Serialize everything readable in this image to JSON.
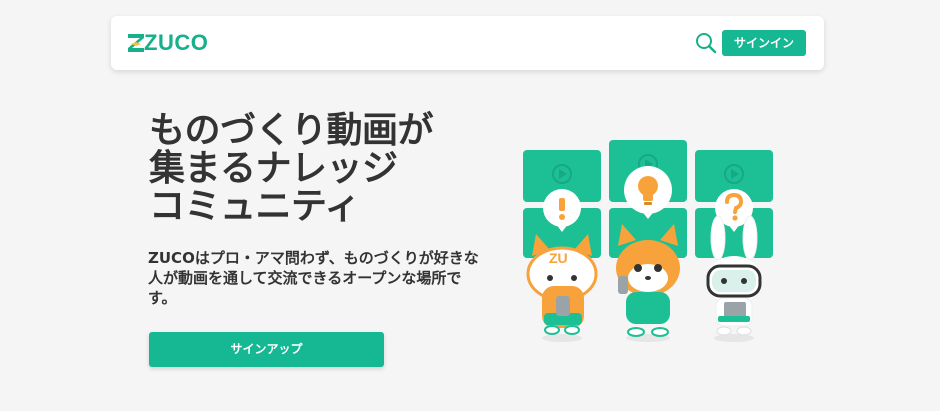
{
  "header": {
    "logo_text": "ZUCO",
    "search_icon": "search-icon",
    "signin_label": "サインイン"
  },
  "hero": {
    "title_line1": "ものづくり動画が",
    "title_line2": "集まるナレッジ",
    "title_line3": "コミュニティ",
    "description": "ZUCOはプロ・アマ問わず、ものづくりが好きな人が動画を通して交流できるオープンな場所です。",
    "signup_label": "サインアップ"
  },
  "illustration": {
    "cat_shirt_text": "ZU",
    "icons": [
      "exclamation-icon",
      "lightbulb-icon",
      "question-icon",
      "play-icon"
    ]
  },
  "colors": {
    "accent": "#16b894",
    "card": "#1dbf95",
    "background": "#f5f5f5",
    "text": "#333333",
    "orange": "#f7a23a"
  }
}
